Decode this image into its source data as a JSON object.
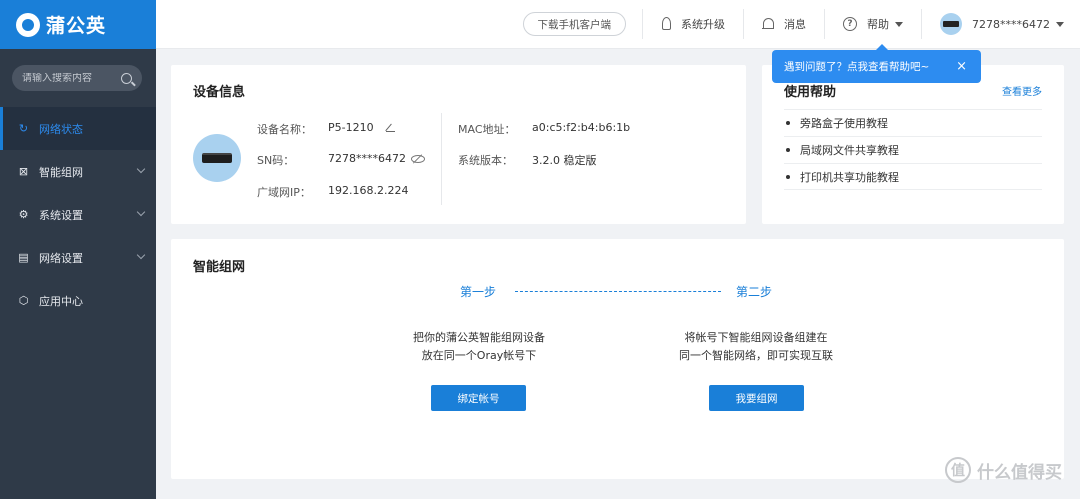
{
  "sidebar": {
    "logo_text": "蒲公英",
    "search_placeholder": "请输入搜索内容",
    "items": [
      {
        "label": "网络状态",
        "icon": "refresh-icon",
        "active": true
      },
      {
        "label": "智能组网",
        "icon": "network-icon"
      },
      {
        "label": "系统设置",
        "icon": "gear-icon"
      },
      {
        "label": "网络设置",
        "icon": "document-icon"
      },
      {
        "label": "应用中心",
        "icon": "cube-icon"
      }
    ]
  },
  "header": {
    "download_label": "下载手机客户端",
    "upgrade_label": "系统升级",
    "message_label": "消息",
    "help_label": "帮助",
    "account_label": "7278****6472"
  },
  "tooltip": {
    "text": "遇到问题了？点我查看帮助吧~",
    "close": "×"
  },
  "device": {
    "title": "设备信息",
    "name_key": "设备名称：",
    "name_value": "P5-1210",
    "sn_key": "SN码：",
    "sn_value": "7278****6472",
    "wan_key": "广域网IP：",
    "wan_value": "192.168.2.224",
    "mac_key": "MAC地址：",
    "mac_value": "a0:c5:f2:b4:b6:1b",
    "version_key": "系统版本：",
    "version_value": "3.2.0 稳定版"
  },
  "help": {
    "title": "使用帮助",
    "more": "查看更多",
    "items": [
      "旁路盒子使用教程",
      "局域网文件共享教程",
      "打印机共享功能教程"
    ]
  },
  "network": {
    "title": "智能组网",
    "step1": "第一步",
    "step2": "第二步",
    "step1_line1": "把你的蒲公英智能组网设备",
    "step1_line2": "放在同一个Oray帐号下",
    "step2_line1": "将帐号下智能组网设备组建在",
    "step2_line2": "同一个智能网络，即可实现互联",
    "bind_button": "绑定帐号",
    "join_button": "我要组网"
  },
  "watermark": {
    "text": "什么值得买",
    "mark": "值"
  }
}
